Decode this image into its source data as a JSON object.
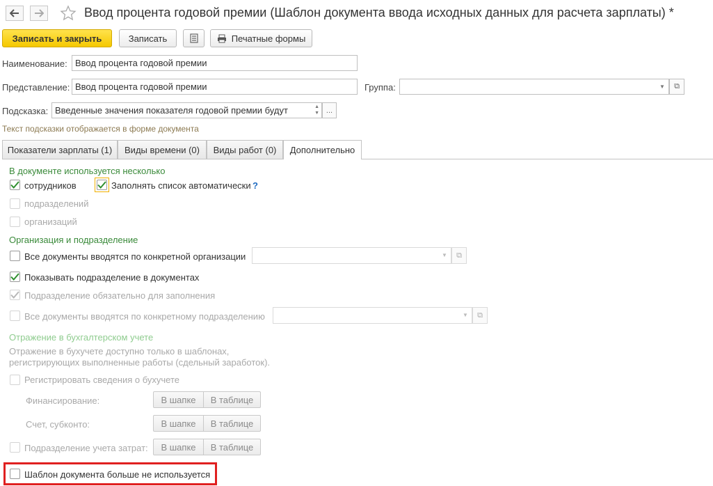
{
  "window": {
    "title": "Ввод процента годовой премии (Шаблон документа ввода исходных данных для расчета зарплаты) *"
  },
  "toolbar": {
    "save_close_label": "Записать и закрыть",
    "save_label": "Записать",
    "print_forms_label": "Печатные формы"
  },
  "form": {
    "name_label": "Наименование:",
    "name_value": "Ввод процента годовой премии",
    "representation_label": "Представление:",
    "representation_value": "Ввод процента годовой премии",
    "group_label": "Группа:",
    "group_value": "",
    "hint_label": "Подсказка:",
    "hint_value": "Введенные значения показателя годовой премии будут",
    "hint_note": "Текст подсказки отображается в форме документа"
  },
  "tabs": [
    {
      "label": "Показатели зарплаты (1)"
    },
    {
      "label": "Виды времени (0)"
    },
    {
      "label": "Виды работ (0)"
    },
    {
      "label": "Дополнительно"
    }
  ],
  "sections": {
    "multi": {
      "title": "В документе используется несколько",
      "employees": "сотрудников",
      "fill_auto": "Заполнять список автоматически",
      "help": "?",
      "departments": "подразделений",
      "organizations": "организаций"
    },
    "org": {
      "title": "Организация и подразделение",
      "by_org": "Все документы вводятся по конкретной организации",
      "show_dept": "Показывать подразделение в документах",
      "dept_required": "Подразделение обязательно для заполнения",
      "by_dept": "Все документы вводятся по конкретному подразделению"
    },
    "accounting": {
      "title": "Отражение в бухгалтерском учете",
      "note_line1": "Отражение в бухучете доступно только в шаблонах,",
      "note_line2": "регистрирующих выполненные работы (сдельный заработок).",
      "register": "Регистрировать сведения о бухучете",
      "financing": "Финансирование:",
      "account": "Счет, субконто:",
      "cost_dept": "Подразделение учета затрат:",
      "in_header": "В шапке",
      "in_table": "В таблице"
    },
    "not_used": "Шаблон документа больше не используется"
  },
  "checks": {
    "employees": true,
    "fill_auto": true,
    "departments": false,
    "organizations": false,
    "by_org": false,
    "show_dept": true,
    "dept_required": true,
    "by_dept": false,
    "register": false,
    "cost_dept": false,
    "not_used": false
  },
  "colors": {
    "accent": "#f5c800",
    "group_title": "#3a8a3a",
    "hint_text": "#8c7a52",
    "highlight": "#e02020"
  }
}
